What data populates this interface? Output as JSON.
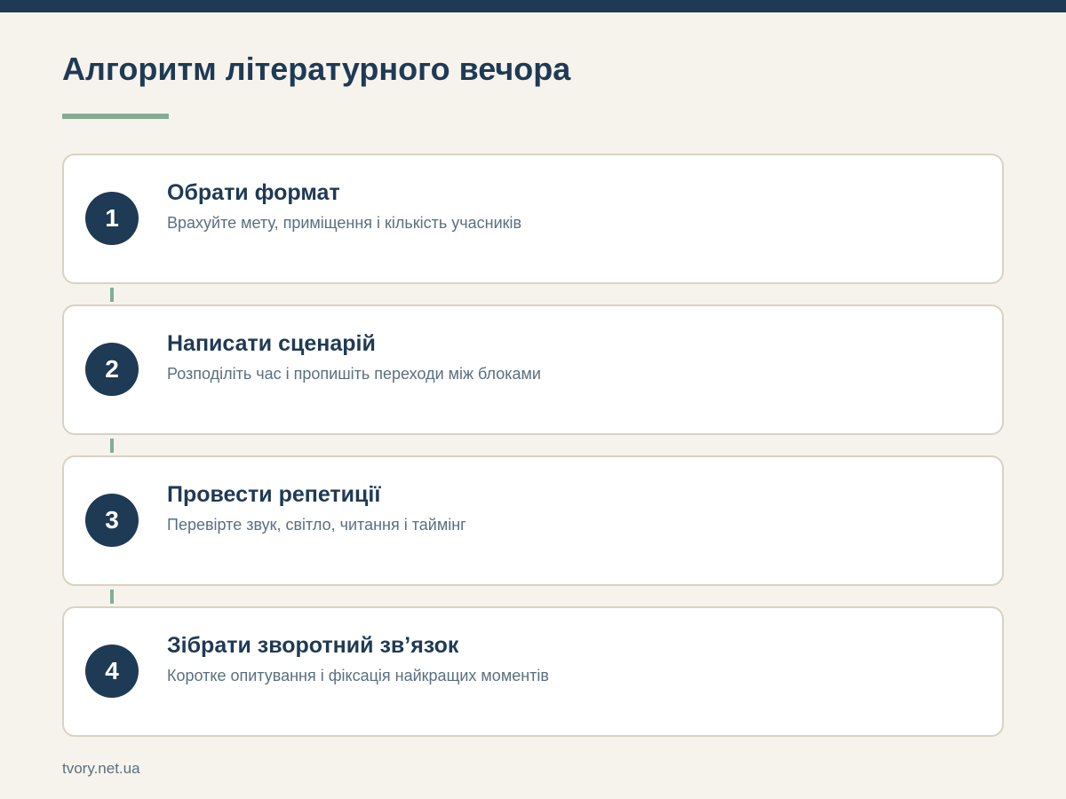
{
  "header": {
    "title": "Алгоритм літературного вечора"
  },
  "steps": [
    {
      "number": "1",
      "title": "Обрати формат",
      "description": "Врахуйте мету, приміщення і кількість учасників"
    },
    {
      "number": "2",
      "title": "Написати сценарій",
      "description": "Розподіліть час і пропишіть переходи між блоками"
    },
    {
      "number": "3",
      "title": "Провести репетиції",
      "description": "Перевірте звук, світло, читання і таймінг"
    },
    {
      "number": "4",
      "title": "Зібрати зворотний зв’язок",
      "description": "Коротке опитування і фіксація найкращих моментів"
    }
  ],
  "footer": {
    "source": "tvory.net.ua"
  },
  "colors": {
    "primary": "#1f3a54",
    "accent": "#84ad93",
    "background": "#f6f3ed",
    "card_border": "#d9d2c3",
    "muted_text": "#5b6f80"
  }
}
